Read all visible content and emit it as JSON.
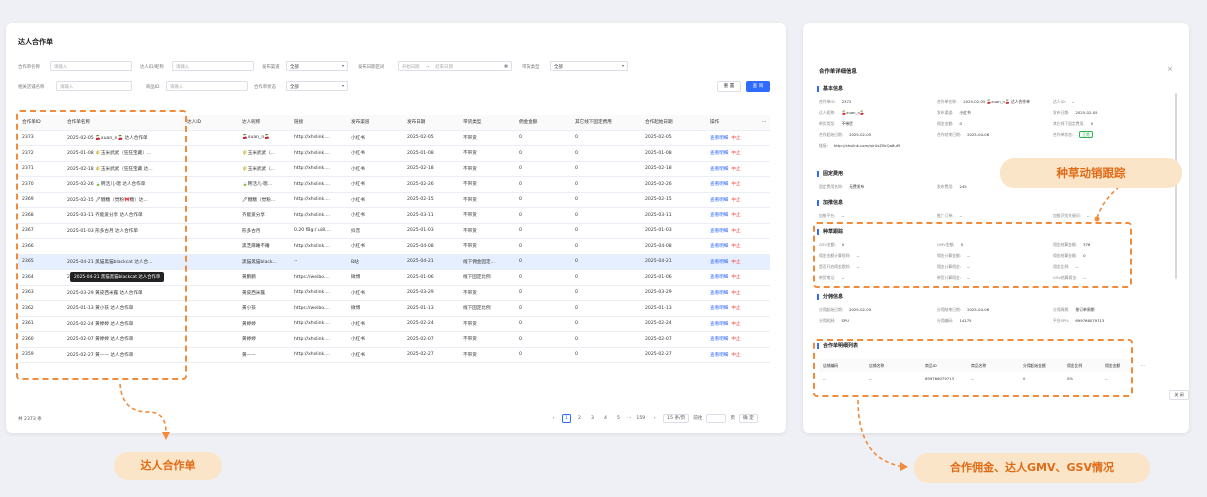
{
  "list": {
    "title": "达人合作单",
    "filters": [
      {
        "label": "合作单名称",
        "placeholder": "请输入"
      },
      {
        "label": "达人ID/昵称",
        "placeholder": "请输入"
      },
      {
        "label": "发布渠道",
        "value": "全部"
      },
      {
        "label": "发布日期区间",
        "start": "开始日期",
        "end": "结束日期"
      },
      {
        "label": "带货类型",
        "value": "全部"
      },
      {
        "label": "相关店铺名称",
        "placeholder": "请输入"
      },
      {
        "label": "商品ID",
        "placeholder": "请输入"
      },
      {
        "label": "合作单状态",
        "value": "全部"
      }
    ],
    "date_arrow": "→",
    "reset_label": "重 置",
    "query_label": "查 询",
    "columns": [
      "合作单ID",
      "合作单名称",
      "达人ID",
      "达人昵称",
      "链接",
      "发布渠道",
      "发布日期",
      "带货类型",
      "佣金金额",
      "其它线下固定费用",
      "合作起始日期",
      "操作"
    ],
    "more": "···",
    "view": "查看明细",
    "stop": "中止",
    "rows": [
      {
        "id": "2373",
        "name": "2025-02-05 🍒xuan_n🍒 达人合作单",
        "nick": "🍒xuan_n🍒",
        "link": "http://xhslink....",
        "ch": "小红书",
        "date": "2025-02-05",
        "type": "不带货",
        "comm": "0",
        "fee": "0",
        "start": "2025-02-05"
      },
      {
        "id": "2372",
        "name": "2025-01-08 🌾玉米武武（狂狂宝藏）...",
        "nick": "🌾玉米武武（...",
        "link": "http://xhslink....",
        "ch": "小红书",
        "date": "2025-01-08",
        "type": "不带货",
        "comm": "0",
        "fee": "0",
        "start": "2025-01-08"
      },
      {
        "id": "2371",
        "name": "2025-02-18 🌾玉米武武（狂狂宝藏 达...",
        "nick": "🌾玉米武武（...",
        "link": "http://xhslink....",
        "ch": "小红书",
        "date": "2025-02-18",
        "type": "不带货",
        "comm": "0",
        "fee": "0",
        "start": "2025-02-18"
      },
      {
        "id": "2370",
        "name": "2025-02-26 🍃韩活儿-嗯 达人合作单",
        "nick": "🍃韩活儿-嗯...",
        "link": "http://xhslink....",
        "ch": "小红书",
        "date": "2025-02-26",
        "type": "不带货",
        "comm": "0",
        "fee": "0",
        "start": "2025-02-26"
      },
      {
        "id": "2369",
        "name": "2025-02-15 🖊糖糖（觉粉🎀糖）达...",
        "nick": "🖊糖糖（觉粉...",
        "link": "http://xhslink....",
        "ch": "小红书",
        "date": "2025-02-15",
        "type": "不带货",
        "comm": "0",
        "fee": "0",
        "start": "2025-02-15"
      },
      {
        "id": "2368",
        "name": "2025-03-11 齐能爱分享 达人合作单",
        "nick": "齐能爱分享",
        "link": "http://xhslink....",
        "ch": "小红书",
        "date": "2025-03-11",
        "type": "不带货",
        "comm": "0",
        "fee": "0",
        "start": "2025-03-11"
      },
      {
        "id": "2367",
        "name": "2025-01-03 形多古月 达人合作单",
        "nick": "形多古月",
        "link": "0.20 fBg:/ ui8....",
        "ch": "抖音",
        "date": "2025-01-03",
        "type": "不带货",
        "comm": "0",
        "fee": "0",
        "start": "2025-01-03"
      },
      {
        "id": "2366",
        "name": "",
        "nick": "黑芝麻睡不睡",
        "link": "http://xhslink....",
        "ch": "小红书",
        "date": "2025-04-08",
        "type": "不带货",
        "comm": "0",
        "fee": "0",
        "start": "2025-04-08"
      },
      {
        "id": "2365",
        "name": "2025-04-21 黑猫黑猫blackcat 达人合...",
        "nick": "黑猫黑猫black...",
        "link": "--",
        "ch": "B站",
        "date": "2025-04-21",
        "type": "线下佣金固定...",
        "comm": "0",
        "fee": "0",
        "start": "2025-04-21"
      },
      {
        "id": "2364",
        "name": "2025-01-06 黄鹏鹏 达人合作单",
        "nick": "黄鹏鹏",
        "link": "https://weibo....",
        "ch": "微博",
        "date": "2025-01-06",
        "type": "线下固定比例",
        "comm": "0",
        "fee": "0",
        "start": "2025-01-06"
      },
      {
        "id": "2363",
        "name": "2025-03-29 黄皮西米露 达人合作单",
        "nick": "黄皮西米露",
        "link": "http://xhslink....",
        "ch": "小红书",
        "date": "2025-03-29",
        "type": "不带货",
        "comm": "0",
        "fee": "0",
        "start": "2025-03-29"
      },
      {
        "id": "2362",
        "name": "2025-01-13 黄小孩 达人合作单",
        "nick": "黄小孩",
        "link": "https://weibo....",
        "ch": "微博",
        "date": "2025-01-13",
        "type": "线下固定比例",
        "comm": "0",
        "fee": "0",
        "start": "2025-01-13"
      },
      {
        "id": "2361",
        "name": "2025-02-24 黄婷婷 达人合作单",
        "nick": "黄婷婷",
        "link": "http://xhslink....",
        "ch": "小红书",
        "date": "2025-02-24",
        "type": "不带货",
        "comm": "0",
        "fee": "0",
        "start": "2025-02-24"
      },
      {
        "id": "2360",
        "name": "2025-02-07 黄婷婷 达人合作单",
        "nick": "黄婷婷",
        "link": "http://xhslink....",
        "ch": "小红书",
        "date": "2025-02-07",
        "type": "不带货",
        "comm": "0",
        "fee": "0",
        "start": "2025-02-07"
      },
      {
        "id": "2359",
        "name": "2025-02-27 黄—— 达人合作单",
        "nick": "黄——",
        "link": "http://xhslink....",
        "ch": "小红书",
        "date": "2025-02-27",
        "type": "不带货",
        "comm": "0",
        "fee": "0",
        "start": "2025-02-27"
      }
    ],
    "tooltip": "2025-04-21 黑猫黑猫blackcat 达人合作单",
    "total": "共 2373 条",
    "pager": {
      "prev": "‹",
      "pages": [
        "1",
        "2",
        "3",
        "4",
        "5"
      ],
      "ellipsis": "···",
      "last": "159",
      "next": "›",
      "size": "15 条/页",
      "goto": "前往",
      "page_unit": "页",
      "confirm": "确 定"
    }
  },
  "detail": {
    "title": "合作单详细信息",
    "close": "×",
    "basic": {
      "title": "基本信息",
      "items": [
        {
          "k": "合作单ID:",
          "v": "2372"
        },
        {
          "k": "合作单名称:",
          "v": "2025-02-05 🍒xuan_n🍒 达人合作单"
        },
        {
          "k": "达人ID:",
          "v": "--"
        },
        {
          "k": "达人昵称:",
          "v": "🍒xuan_n🍒"
        },
        {
          "k": "发布渠道:",
          "v": "小红书"
        },
        {
          "k": "发布日期:",
          "v": "2025-02-05"
        },
        {
          "k": "带货类型:",
          "v": "不带货"
        },
        {
          "k": "佣金金额:",
          "v": "0"
        },
        {
          "k": "其它线下固定费用:",
          "v": "0"
        },
        {
          "k": "合作起始日期:",
          "v": "2025-02-05"
        },
        {
          "k": "合作结束日期:",
          "v": "2025-04-06"
        },
        {
          "k": "合作单状态:",
          "v": "正常"
        },
        {
          "k": "链接:",
          "v": "http://xhslink.com/a/rUsZ0kQa8uf5"
        }
      ]
    },
    "fixed": {
      "title": "固定费用",
      "items": [
        {
          "k": "固定费用名称:",
          "v": "无费发布"
        },
        {
          "k": "发布费用:",
          "v": "245"
        }
      ]
    },
    "boost": {
      "title": "加推信息",
      "items": [
        {
          "k": "加推平台:",
          "v": "--"
        },
        {
          "k": "推广订单:",
          "v": "--"
        },
        {
          "k": "加推识别关键词:",
          "v": "--"
        }
      ]
    },
    "grass": {
      "title": "种草跟踪",
      "items": [
        {
          "k": "GSV金额:",
          "v": "0"
        },
        {
          "k": "GMV金额:",
          "v": "0"
        },
        {
          "k": "佣金结算金额:",
          "v": "376"
        },
        {
          "k": "佣金金额计算规则:",
          "v": "--"
        },
        {
          "k": "佣金计算金额:",
          "v": "--"
        },
        {
          "k": "佣金结算金额:",
          "v": "0"
        },
        {
          "k": "是否开启佣金跟踪:",
          "v": "--"
        },
        {
          "k": "佣金计算佣金:",
          "v": "--"
        },
        {
          "k": "佣金比例:",
          "v": "--"
        },
        {
          "k": "带货笔记:",
          "v": "--"
        },
        {
          "k": "带货计算佣金:",
          "v": "--"
        },
        {
          "k": "GSV结算佣金:",
          "v": "--"
        }
      ]
    },
    "split": {
      "title": "分佣信息",
      "items": [
        {
          "k": "分佣起始日期:",
          "v": "2025-02-05"
        },
        {
          "k": "分佣结束日期:",
          "v": "2025-04-06"
        },
        {
          "k": "分佣周期:",
          "v": "按订单周期"
        },
        {
          "k": "分佣机制:",
          "v": "SPU"
        },
        {
          "k": "分佣编码:",
          "v": "14175"
        },
        {
          "k": "平台SPU:",
          "v": "699766079713"
        }
      ]
    },
    "detail_list": {
      "title": "合作单明细列表",
      "columns": [
        "店铺编码",
        "店铺名称",
        "商品ID",
        "商品名称",
        "分佣起始金额",
        "佣金比例",
        "佣金金额"
      ],
      "row": [
        "--",
        "--",
        "699766079713",
        "--",
        "0",
        "0%",
        "--"
      ],
      "more": "···",
      "close_btn": "关 闭"
    }
  },
  "callouts": {
    "list": "达人合作单",
    "grass": "种草动销跟踪",
    "commission": "合作佣金、达人GMV、GSV情况"
  },
  "colors": {
    "accent": "#2f6bff",
    "callout": "#f08c3c",
    "callout_bg": "#fbe5c8"
  }
}
